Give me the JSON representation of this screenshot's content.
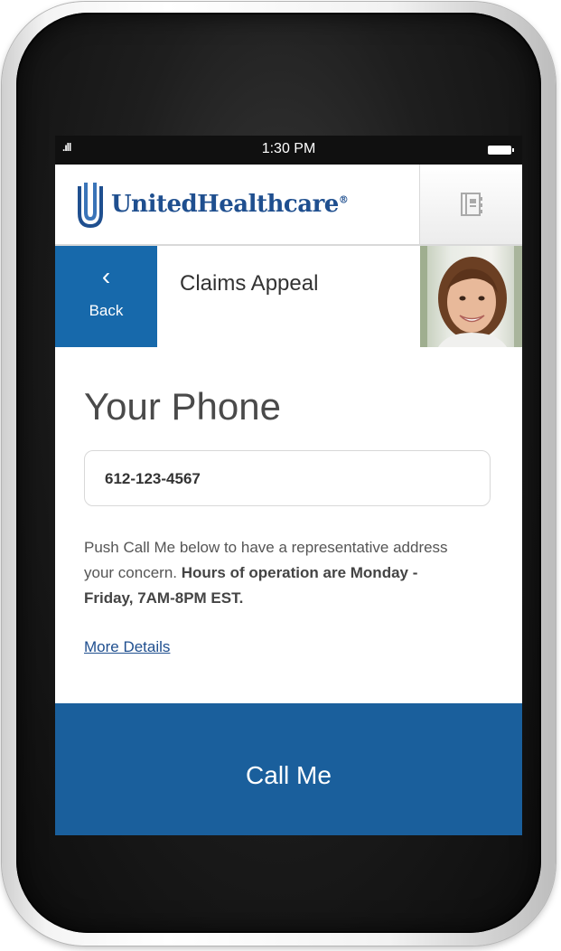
{
  "status_bar": {
    "time": "1:30 PM"
  },
  "header": {
    "brand": "UnitedHealthcare",
    "brand_mark": "®"
  },
  "nav": {
    "back_label": "Back",
    "page_title": "Claims Appeal"
  },
  "main": {
    "section_title": "Your Phone",
    "phone_value": "612-123-4567",
    "info_text": "Push Call Me below to have a representative address your concern.",
    "info_bold": "Hours of operation are Monday - Friday, 7AM-8PM EST.",
    "more_details": "More Details"
  },
  "actions": {
    "call_me": "Call Me"
  },
  "colors": {
    "primary_blue": "#1a5f9c",
    "back_blue": "#1769ab",
    "brand_text": "#1f4f8f"
  },
  "icons": [
    "signal-icon",
    "battery-icon",
    "logo-icon",
    "contacts-icon",
    "chevron-left-icon"
  ]
}
